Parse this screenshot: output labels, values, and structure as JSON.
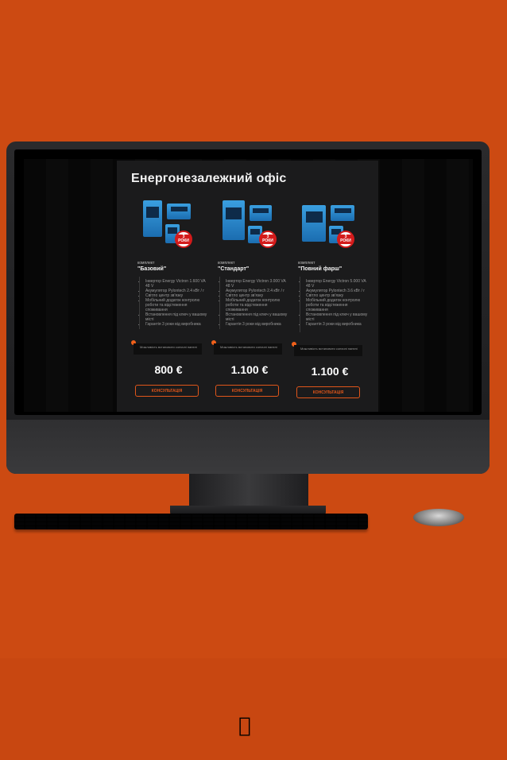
{
  "site": {
    "title": "Енергонезалежний офіс",
    "plans": [
      {
        "kind": "комплект",
        "name": "\"Базовий\"",
        "badge": "3 РОКИ",
        "features": [
          "Інвертор Energy Victron 1.600 VA 48 V",
          "Акумулятор Pylontech 2.4 кВт / г",
          "Світло центр зв'язку",
          "Мобільний додаток контролю роботи та відстеження споживання",
          "Встановлення під ключ у вашому місті",
          "Гарантія 3 роки від виробника"
        ],
        "option": "Можливість встановити сонячні панелі",
        "price": "800 €",
        "button": "КОНСУЛЬТАЦІЯ"
      },
      {
        "kind": "комплект",
        "name": "\"Стандарт\"",
        "badge": "3 РОКИ",
        "features": [
          "Інвертор Energy Victron 3.000 VA 48 V",
          "Акумулятор Pylontech 2.4 кВт / г",
          "Світло центр зв'язку",
          "Мобільний додаток контролю роботи та відстеження споживання",
          "Встановлення під ключ у вашому місті",
          "Гарантія 3 роки від виробника"
        ],
        "option": "Можливість встановити сонячні панелі",
        "price": "1.100 €",
        "button": "КОНСУЛЬТАЦІЯ"
      },
      {
        "kind": "комплект",
        "name": "\"Повний фарш\"",
        "badge": "3 РОКИ",
        "features": [
          "Інвертор Energy Victron 5.000 VA 48 V",
          "Акумулятор Pylontech 3.6 кВт / г",
          "Світло центр зв'язку",
          "Мобільний додаток контролю роботи та відстеження споживання",
          "Встановлення під ключ у вашому місті",
          "Гарантія 3 роки від виробника"
        ],
        "option": "Можливість встановити сонячні панелі",
        "price": "1.100 €",
        "button": "КОНСУЛЬТАЦІЯ"
      }
    ]
  },
  "colors": {
    "background": "#cc4a12",
    "panel": "#1b1b1c",
    "accent": "#e0561a",
    "device": "#2a8fd6",
    "badge_red": "#d41b1b"
  },
  "icons": {
    "monitor_logo": "apple-logo-icon"
  }
}
